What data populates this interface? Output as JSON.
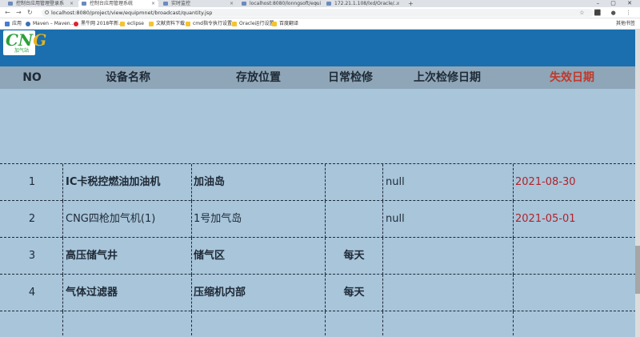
{
  "browser": {
    "tabs": [
      {
        "title": "控制台应用管理登录系"
      },
      {
        "title": "控制台应用管理系统"
      },
      {
        "title": "实时监控"
      },
      {
        "title": "localhost:8080/lonngsoft/equi"
      },
      {
        "title": "172.21.1.108/lxd/Oracle/..."
      }
    ],
    "new_tab": "+",
    "url": "localhost:8080/project/view/equipmnet/broadcast/quantity.jsp",
    "bookmarks": [
      {
        "label": "应用"
      },
      {
        "label": "Maven – Maven…"
      },
      {
        "label": "黑牛网 2018年新…"
      },
      {
        "label": "eclipse"
      },
      {
        "label": "文献资料下载"
      },
      {
        "label": "cmd指令执行设置"
      },
      {
        "label": "Oracle运行设置"
      },
      {
        "label": "百度翻译"
      }
    ],
    "other_bookmarks": "其他书签"
  },
  "app": {
    "logo": {
      "mark_c": "C",
      "mark_n": "N",
      "mark_g": "G",
      "sub": "加气站"
    },
    "columns": [
      "NO",
      "设备名称",
      "存放位置",
      "日常检修",
      "上次检修日期",
      "失效日期"
    ],
    "rows": [
      {
        "no": "1",
        "name": "IC卡税控燃油加油机",
        "location": "加油岛",
        "daily": "",
        "last": "null",
        "expire": "2021-08-30"
      },
      {
        "no": "2",
        "name": "CNG四枪加气机(1)",
        "location": "1号加气岛",
        "daily": "",
        "last": "null",
        "expire": "2021-05-01"
      },
      {
        "no": "3",
        "name": "高压储气井",
        "location": "储气区",
        "daily": "每天",
        "last": "",
        "expire": ""
      },
      {
        "no": "4",
        "name": "气体过滤器",
        "location": "压缩机内部",
        "daily": "每天",
        "last": "",
        "expire": ""
      }
    ],
    "colors": {
      "header": "#1b6fae",
      "table_bg": "#a8c5da",
      "column_head": "#8ea6b8",
      "expire_text": "#b0232b"
    }
  }
}
